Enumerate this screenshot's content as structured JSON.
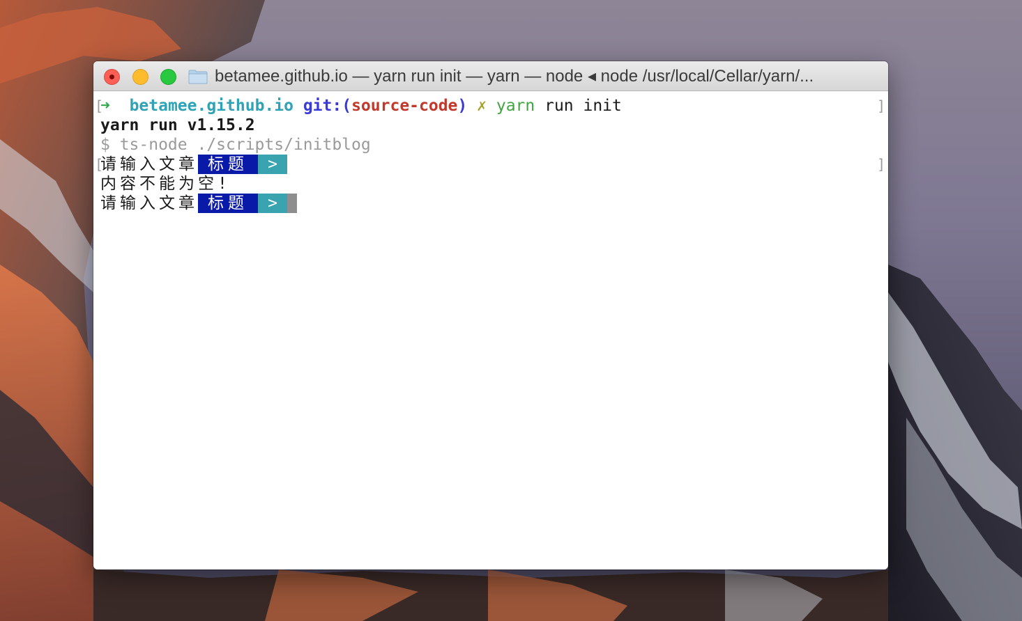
{
  "window": {
    "title": "betamee.github.io — yarn run init — yarn — node ◂ node /usr/local/Cellar/yarn/..."
  },
  "terminal": {
    "prompt": {
      "arrow": "➜",
      "dir": "betamee.github.io",
      "git_prefix": "git:(",
      "branch": "source-code",
      "git_suffix": ")",
      "dirty": "✗",
      "cmd_name": "yarn",
      "cmd_args": "run init"
    },
    "line_version": "yarn run v1.15.2",
    "line_script": "$ ts-node ./scripts/initblog",
    "prompt_question": "请输入文章",
    "prompt_badge": "标题",
    "prompt_arrow": ">",
    "error_message": "内容不能为空!",
    "prompt_question_2": "请输入文章",
    "prompt_badge_2": "标题",
    "prompt_arrow_2": ">",
    "mark_left": "[",
    "mark_right": "]"
  },
  "colors": {
    "close": "#fd5f57",
    "minimize": "#fdbc2e",
    "maximize": "#28c840",
    "badge_title_bg": "#0a1aa8",
    "badge_arrow_bg": "#3aa3b0"
  },
  "icons": [
    "close-button",
    "minimize-button",
    "maximize-button",
    "folder-icon"
  ]
}
